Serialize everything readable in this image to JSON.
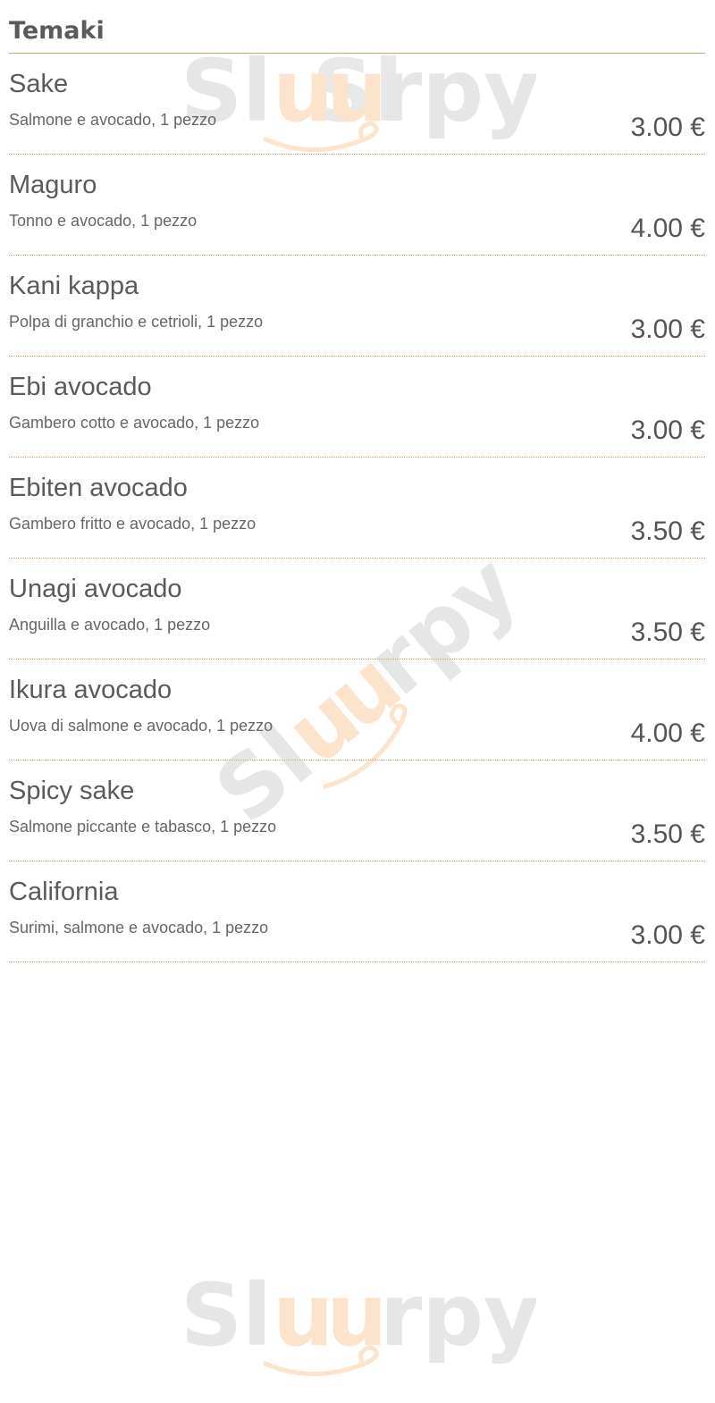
{
  "watermark": {
    "text": "Sluurpy",
    "text_color": "#e6e6e6",
    "accent_color": "#fbe3cc"
  },
  "menu": {
    "section_title": "Temaki",
    "divider_color": "#c9a66b",
    "items": [
      {
        "name": "Sake",
        "description": "Salmone e avocado, 1 pezzo",
        "price": "3.00 €"
      },
      {
        "name": "Maguro",
        "description": "Tonno e avocado, 1 pezzo",
        "price": "4.00 €"
      },
      {
        "name": "Kani kappa",
        "description": "Polpa di granchio e cetrioli, 1 pezzo",
        "price": "3.00 €"
      },
      {
        "name": "Ebi avocado",
        "description": "Gambero cotto e avocado, 1 pezzo",
        "price": "3.00 €"
      },
      {
        "name": "Ebiten avocado",
        "description": "Gambero fritto e avocado, 1 pezzo",
        "price": "3.50 €"
      },
      {
        "name": "Unagi avocado",
        "description": "Anguilla e avocado, 1 pezzo",
        "price": "3.50 €"
      },
      {
        "name": "Ikura avocado",
        "description": "Uova di salmone e avocado, 1 pezzo",
        "price": "4.00 €"
      },
      {
        "name": "Spicy sake",
        "description": "Salmone piccante e tabasco, 1 pezzo",
        "price": "3.50 €"
      },
      {
        "name": "California",
        "description": "Surimi, salmone e avocado, 1 pezzo",
        "price": "3.00 €"
      }
    ]
  }
}
